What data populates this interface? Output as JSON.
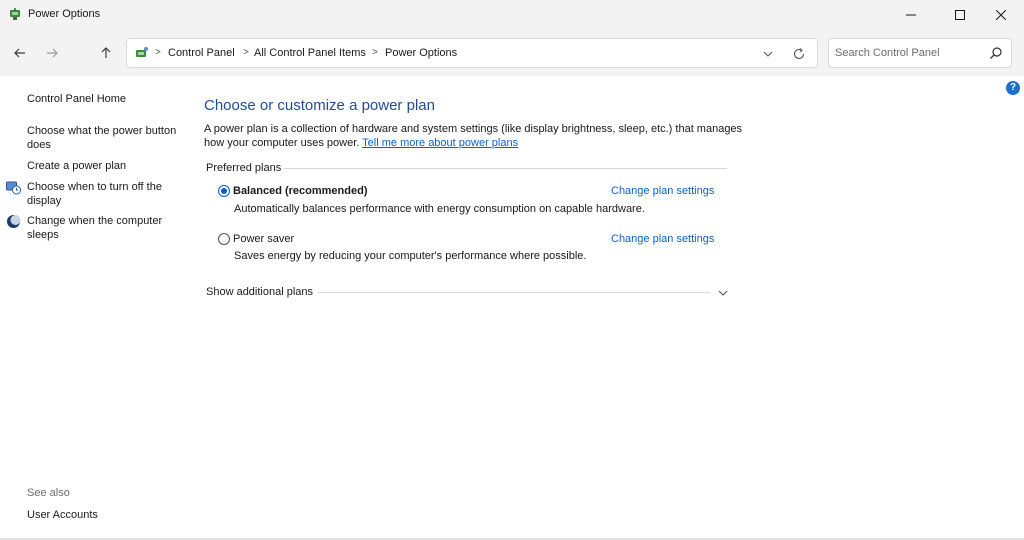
{
  "window": {
    "title": "Power Options",
    "app_icon": "power-options-icon"
  },
  "navigation": {
    "back_icon": "back-arrow-icon",
    "forward_icon": "forward-arrow-icon",
    "up_icon": "up-arrow-icon",
    "breadcrumbs": [
      "Control Panel",
      "All Control Panel Items",
      "Power Options"
    ],
    "separator": ">",
    "search_placeholder": "Search Control Panel"
  },
  "sidebar": {
    "home_label": "Control Panel Home",
    "items": [
      {
        "label": "Choose what the power button does",
        "icon": null
      },
      {
        "label": "Create a power plan",
        "icon": null
      },
      {
        "label": "Choose when to turn off the display",
        "icon": "display-schedule-icon"
      },
      {
        "label": "Change when the computer sleeps",
        "icon": "sleep-moon-icon"
      }
    ],
    "see_also_label": "See also",
    "see_also_links": [
      "User Accounts"
    ]
  },
  "main": {
    "title": "Choose or customize a power plan",
    "description": "A power plan is a collection of hardware and system settings (like display brightness, sleep, etc.) that manages how your computer uses power.",
    "learn_more_link": "Tell me more about power plans",
    "preferred_plans_label": "Preferred plans",
    "plans": [
      {
        "name": "Balanced (recommended)",
        "selected": true,
        "description": "Automatically balances performance with energy consumption on capable hardware.",
        "settings_link": "Change plan settings"
      },
      {
        "name": "Power saver",
        "selected": false,
        "description": "Saves energy by reducing your computer's performance where possible.",
        "settings_link": "Change plan settings"
      }
    ],
    "additional_plans_label": "Show additional plans"
  },
  "colors": {
    "title_blue": "#1f4e96",
    "link_blue": "#0a63c9",
    "radio_blue": "#0a5dc2",
    "chrome_gray": "#f3f3f3"
  }
}
